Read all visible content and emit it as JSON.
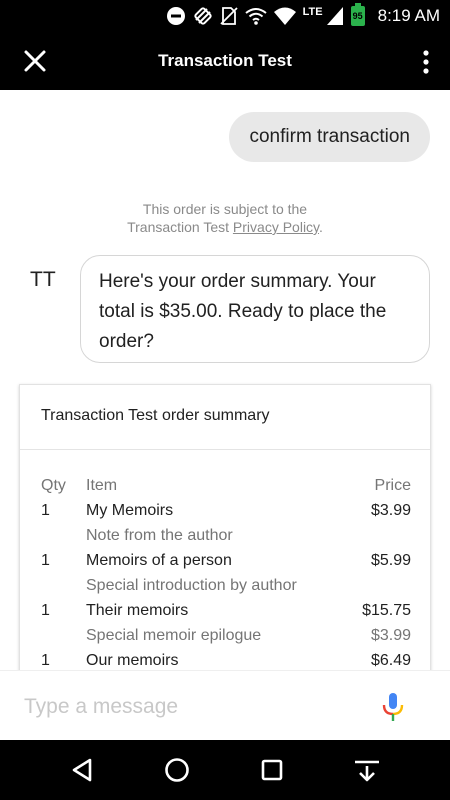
{
  "status_bar": {
    "network_label": "LTE",
    "battery_level": "95",
    "time": "8:19 AM",
    "icons": [
      "dnd-icon",
      "sync-icon",
      "no-sim-icon",
      "wifi-calling-icon",
      "wifi-icon",
      "signal-icon",
      "battery-icon"
    ]
  },
  "app_bar": {
    "title": "Transaction Test",
    "close_icon": "close-icon",
    "more_icon": "more-vert-icon"
  },
  "chat": {
    "user_message": "confirm transaction",
    "disclaimer_line1": "This order is subject to the",
    "disclaimer_prefix": "Transaction Test ",
    "disclaimer_link": "Privacy Policy",
    "disclaimer_suffix": ".",
    "bot_avatar": "TT",
    "bot_message": "Here's your order summary. Your total is $35.00. Ready to place the order?"
  },
  "order_summary": {
    "title": "Transaction Test order summary",
    "columns": {
      "qty": "Qty",
      "item": "Item",
      "price": "Price"
    },
    "rows": [
      {
        "qty": "1",
        "item": "My Memoirs",
        "price": "$3.99",
        "kind": "main"
      },
      {
        "qty": "",
        "item": "Note from the author",
        "price": "",
        "kind": "sub"
      },
      {
        "qty": "1",
        "item": "Memoirs of a person",
        "price": "$5.99",
        "kind": "main"
      },
      {
        "qty": "",
        "item": "Special introduction by author",
        "price": "",
        "kind": "sub"
      },
      {
        "qty": "1",
        "item": "Their memoirs",
        "price": "$15.75",
        "kind": "main"
      },
      {
        "qty": "",
        "item": "Special memoir epilogue",
        "price": "$3.99",
        "kind": "sub"
      },
      {
        "qty": "1",
        "item": "Our memoirs",
        "price": "$6.49",
        "kind": "main"
      }
    ]
  },
  "composer": {
    "placeholder": "Type a message",
    "value": "",
    "mic_icon": "mic-icon"
  },
  "nav_bar": {
    "icons": [
      "back-icon",
      "home-icon",
      "recents-icon",
      "keyboard-hide-icon"
    ]
  },
  "colors": {
    "bar_background": "#000000",
    "user_bubble": "#e8e8e8",
    "battery_green": "#2bb24c",
    "mic_blue": "#4285f4",
    "mic_red": "#ea4335",
    "mic_yellow": "#fbbc05",
    "mic_green": "#34a853"
  }
}
